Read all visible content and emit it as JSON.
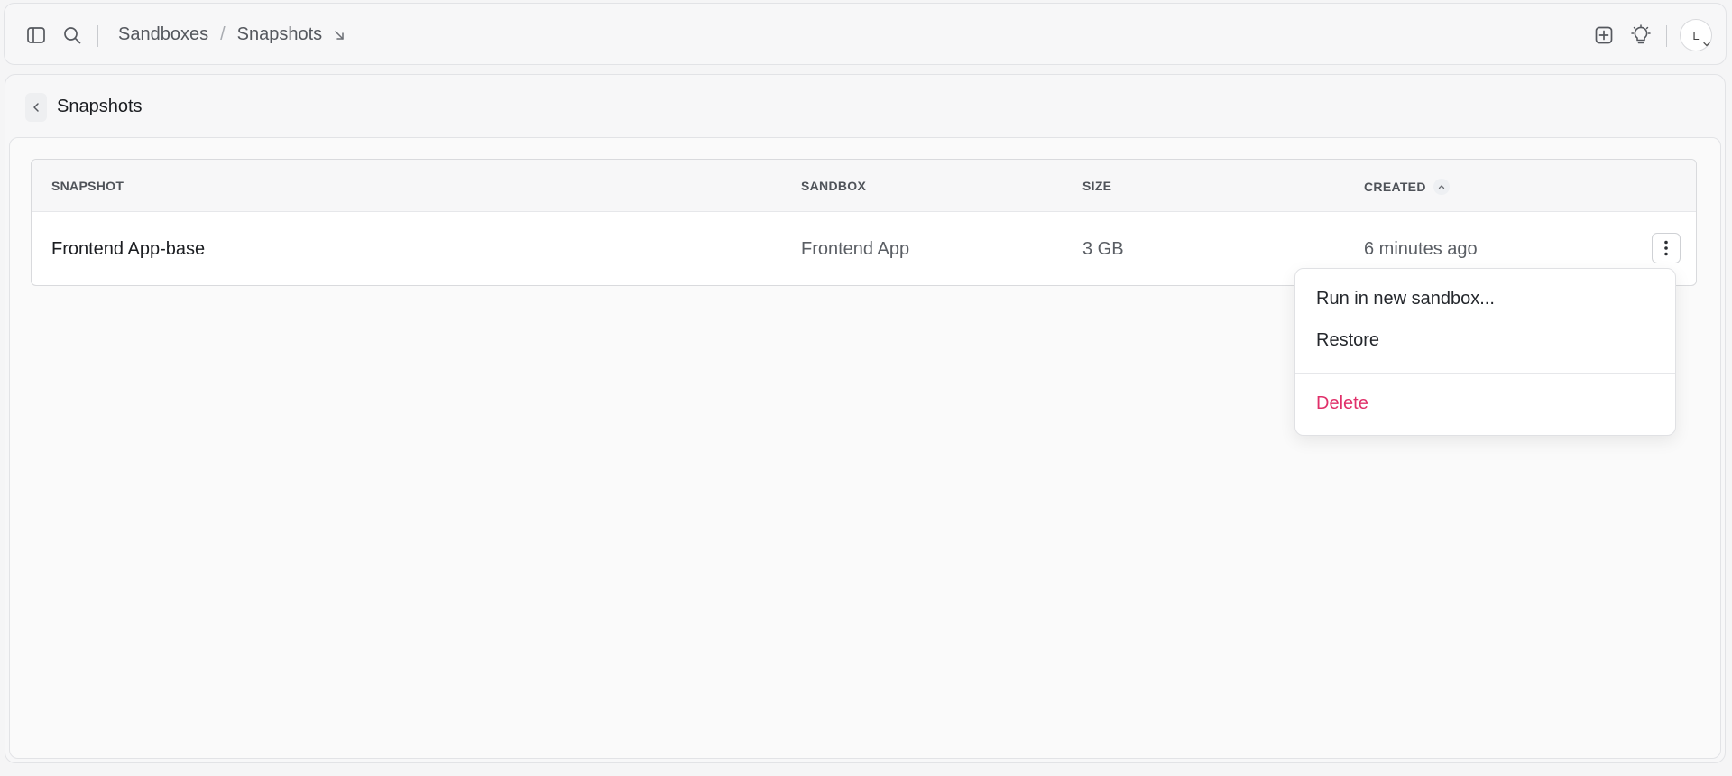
{
  "breadcrumb": {
    "root": "Sandboxes",
    "separator": "/",
    "current": "Snapshots"
  },
  "avatar": {
    "initial": "L"
  },
  "page": {
    "title": "Snapshots"
  },
  "table": {
    "columns": {
      "snapshot": "SNAPSHOT",
      "sandbox": "SANDBOX",
      "size": "SIZE",
      "created": "CREATED"
    },
    "sort": {
      "column": "created",
      "direction": "ascending"
    },
    "rows": [
      {
        "snapshot": "Frontend App-base",
        "sandbox": "Frontend App",
        "size": "3 GB",
        "created": "6 minutes ago"
      }
    ]
  },
  "menu": {
    "run": "Run in new sandbox...",
    "restore": "Restore",
    "delete": "Delete"
  },
  "colors": {
    "danger": "#e0306a",
    "text": "#1b1d21",
    "muted": "#5a5e64"
  },
  "icons": [
    "sidebar-toggle-icon",
    "search-icon",
    "arrow-down-right-icon",
    "plus-square-icon",
    "bulb-icon",
    "chevron-down-icon",
    "chevron-left-icon",
    "chevron-up-icon",
    "vertical-dots-icon"
  ]
}
